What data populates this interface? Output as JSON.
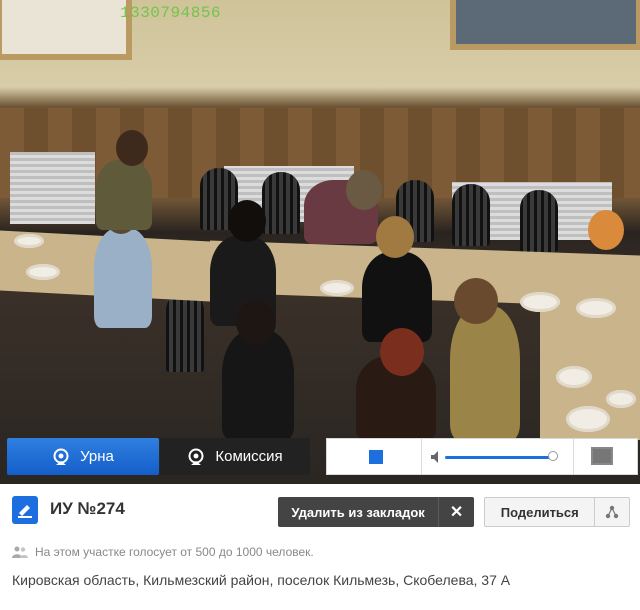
{
  "camera": {
    "stream_id": "1330794856"
  },
  "controls": {
    "urn_label": "Урна",
    "commission_label": "Комиссия",
    "volume_level": 0.9
  },
  "station": {
    "title": "ИУ №274",
    "remove_bookmark_label": "Удалить из закладок",
    "share_label": "Поделиться",
    "voters_text": "На этом участке голосует от 500 до 1000 человек.",
    "address": "Кировская область, Кильмезский район, поселок Кильмезь, Скобелева, 37 А"
  },
  "colors": {
    "accent": "#1d6fe0",
    "dark_button": "#444444",
    "cam_overlay": "#63c43a"
  }
}
